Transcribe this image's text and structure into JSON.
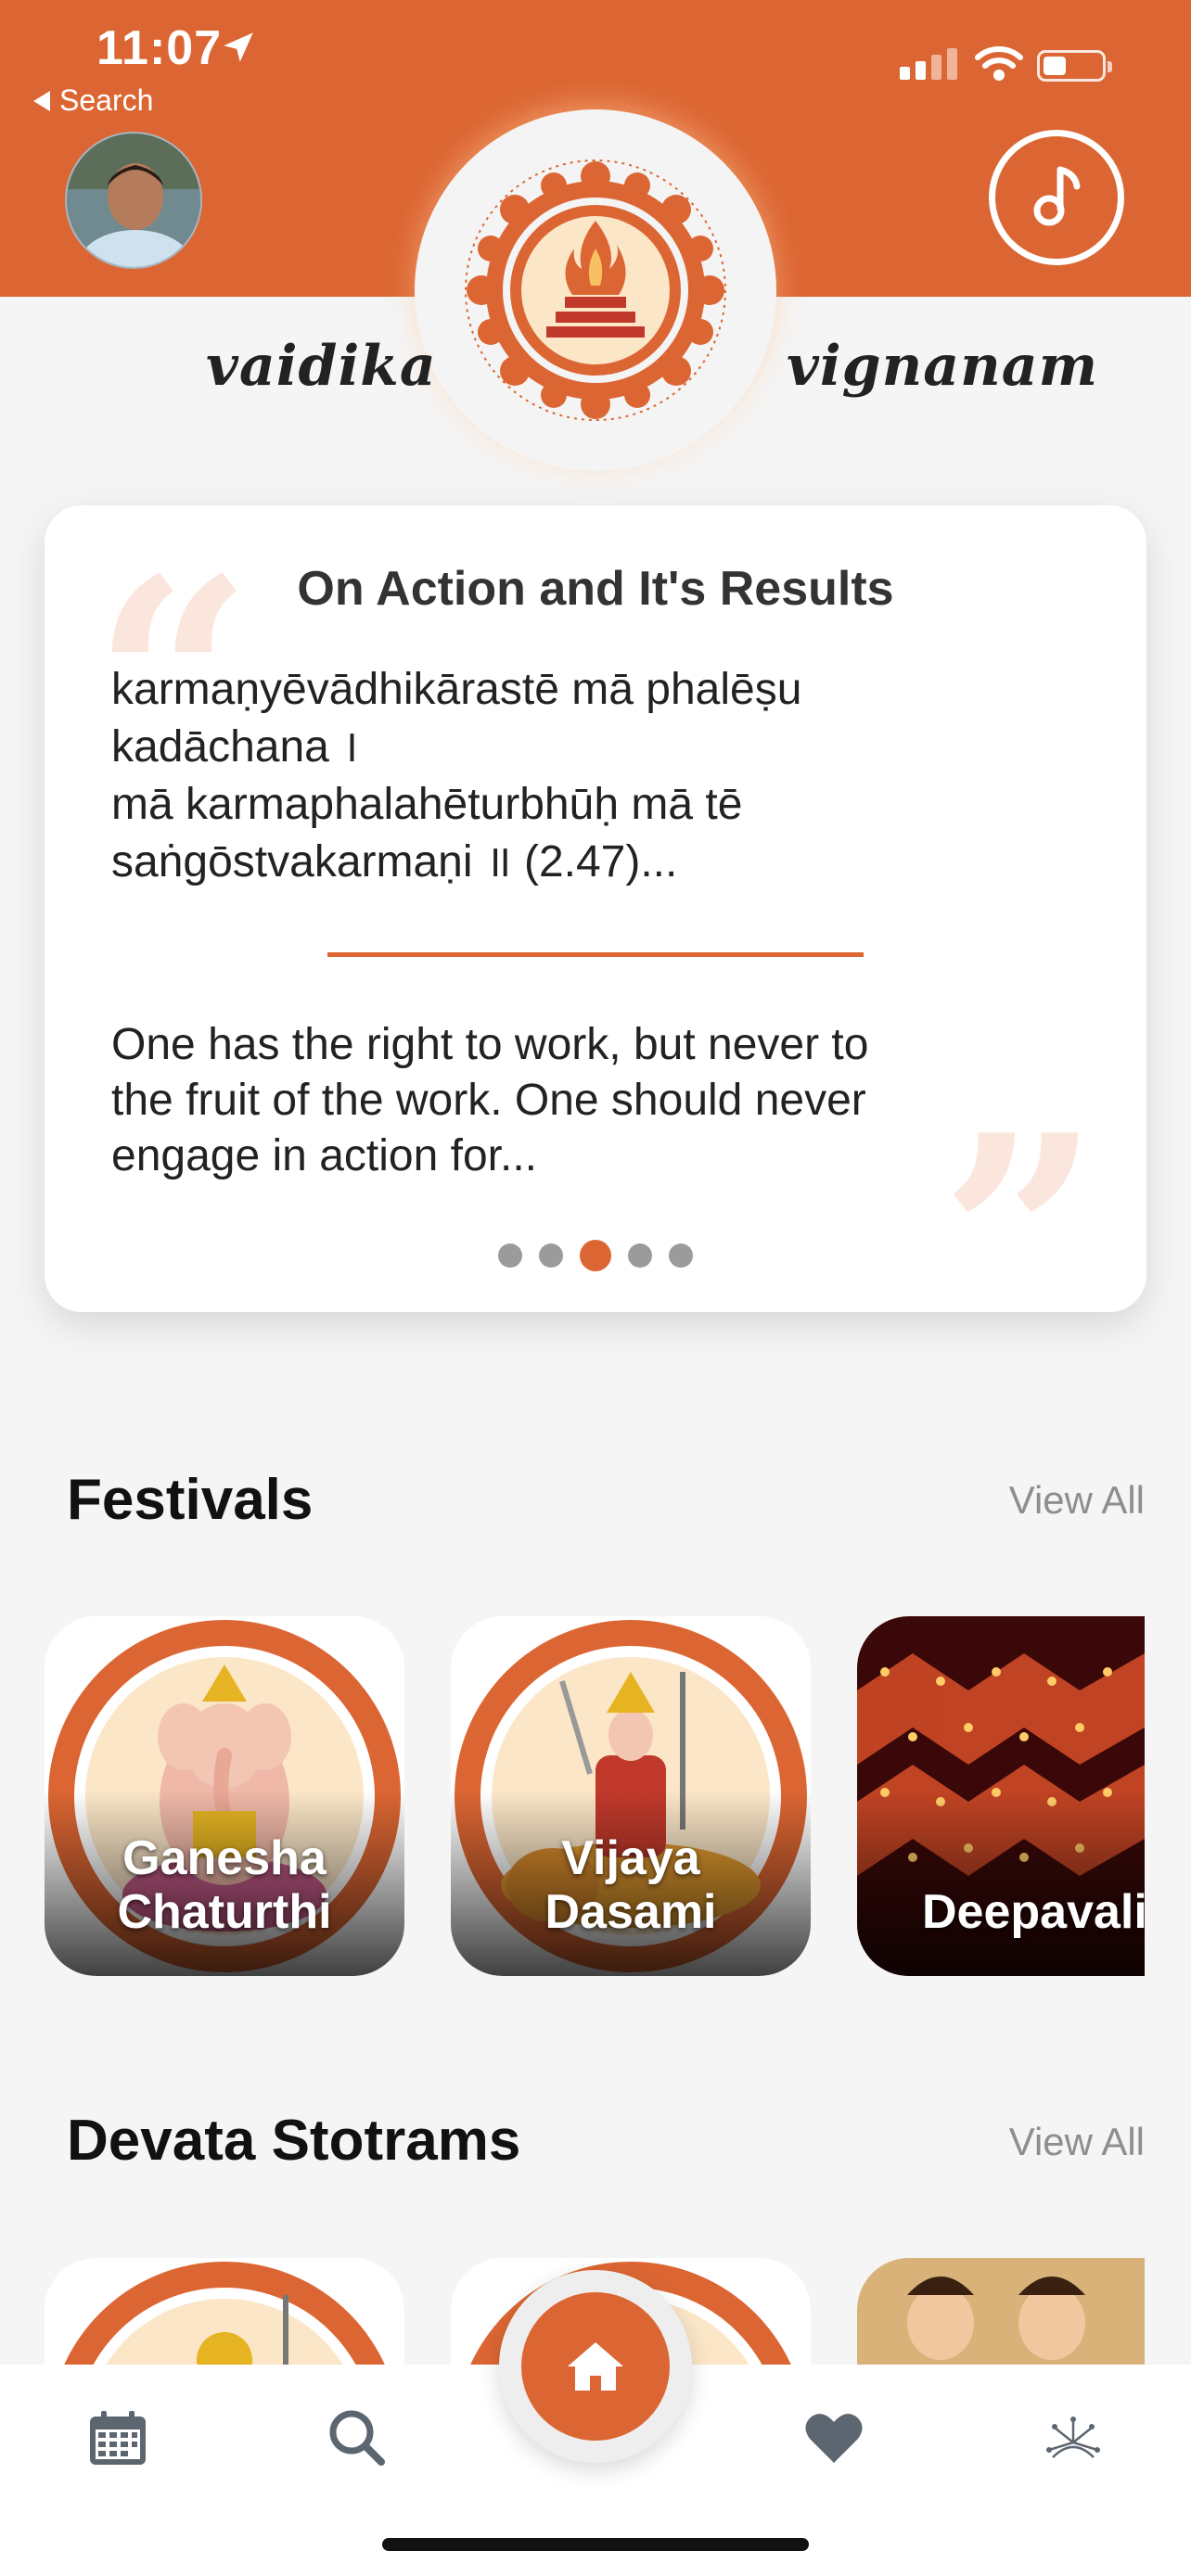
{
  "status_bar": {
    "time": "11:07",
    "back_label": "Search"
  },
  "header": {
    "brand_left": "vaidika",
    "brand_right": "vignanam"
  },
  "quote": {
    "title": "On Action and It's Results",
    "sanskrit_lines": [
      "karmaṇyēvādhikārastē mā phalēṣu",
      "kadāchana ।",
      "mā karmaphalahēturbhūḥ mā tē",
      "saṅgōstvakarmaṇi ॥ (2.47)..."
    ],
    "translation_lines": [
      "One has the right to work, but never to",
      "the fruit of the work. One should never",
      "engage in action for..."
    ],
    "page_count": 5,
    "active_page": 3
  },
  "festivals": {
    "title": "Festivals",
    "view_all": "View All",
    "items": [
      {
        "line1": "Ganesha",
        "line2": "Chaturthi"
      },
      {
        "line1": "Vijaya",
        "line2": "Dasami"
      },
      {
        "line1": "",
        "line2": "Deepavali"
      }
    ]
  },
  "stotrams": {
    "title": "Devata Stotrams",
    "view_all": "View All"
  },
  "tabbar": {
    "items": [
      "calendar-icon",
      "search-icon",
      "home-icon",
      "heart-icon",
      "network-icon"
    ]
  },
  "colors": {
    "accent": "#dc6633",
    "background": "#f5f5f5"
  }
}
